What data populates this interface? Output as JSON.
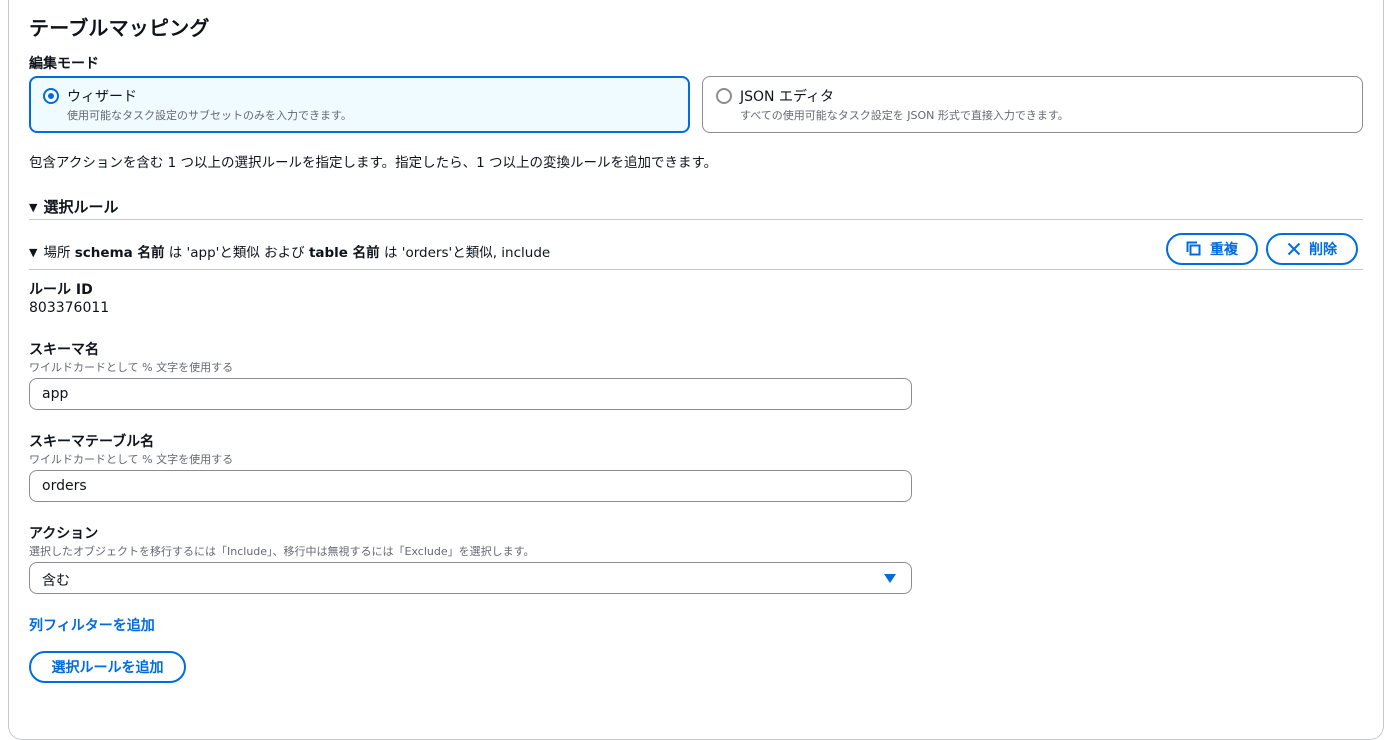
{
  "title": "テーブルマッピング",
  "edit_mode": {
    "label": "編集モード",
    "options": [
      {
        "title": "ウィザード",
        "description": "使用可能なタスク設定のサブセットのみを入力できます。",
        "selected": true
      },
      {
        "title": "JSON エディタ",
        "description": "すべての使用可能なタスク設定を JSON 形式で直接入力できます。",
        "selected": false
      }
    ]
  },
  "intro_text": "包含アクションを含む 1 つ以上の選択ルールを指定します。指定したら、1 つ以上の変換ルールを追加できます。",
  "selection_rules": {
    "header": "選択ルール",
    "rule": {
      "summary_parts": {
        "p1": "場所 ",
        "k1": "schema 名前",
        "p2": " は 'app'と類似 および ",
        "k2": "table 名前",
        "p3": " は 'orders'と類似, include"
      },
      "copy_label": "重複",
      "delete_label": "削除",
      "rule_id_label": "ルール ID",
      "rule_id": "803376011",
      "schema": {
        "label": "スキーマ名",
        "hint": "ワイルドカードとして % 文字を使用する",
        "value": "app"
      },
      "table": {
        "label": "スキーマテーブル名",
        "hint": "ワイルドカードとして % 文字を使用する",
        "value": "orders"
      },
      "action": {
        "label": "アクション",
        "hint": "選択したオブジェクトを移行するには「Include」、移行中は無視するには「Exclude」を選択します。",
        "value": "含む"
      }
    },
    "add_column_filter_label": "列フィルターを追加",
    "add_rule_label": "選択ルールを追加"
  },
  "colors": {
    "accent": "#006ce0",
    "selected_bg": "#f0fbff",
    "border": "#8c8c94",
    "text": "#0f141a",
    "muted": "#656871"
  }
}
